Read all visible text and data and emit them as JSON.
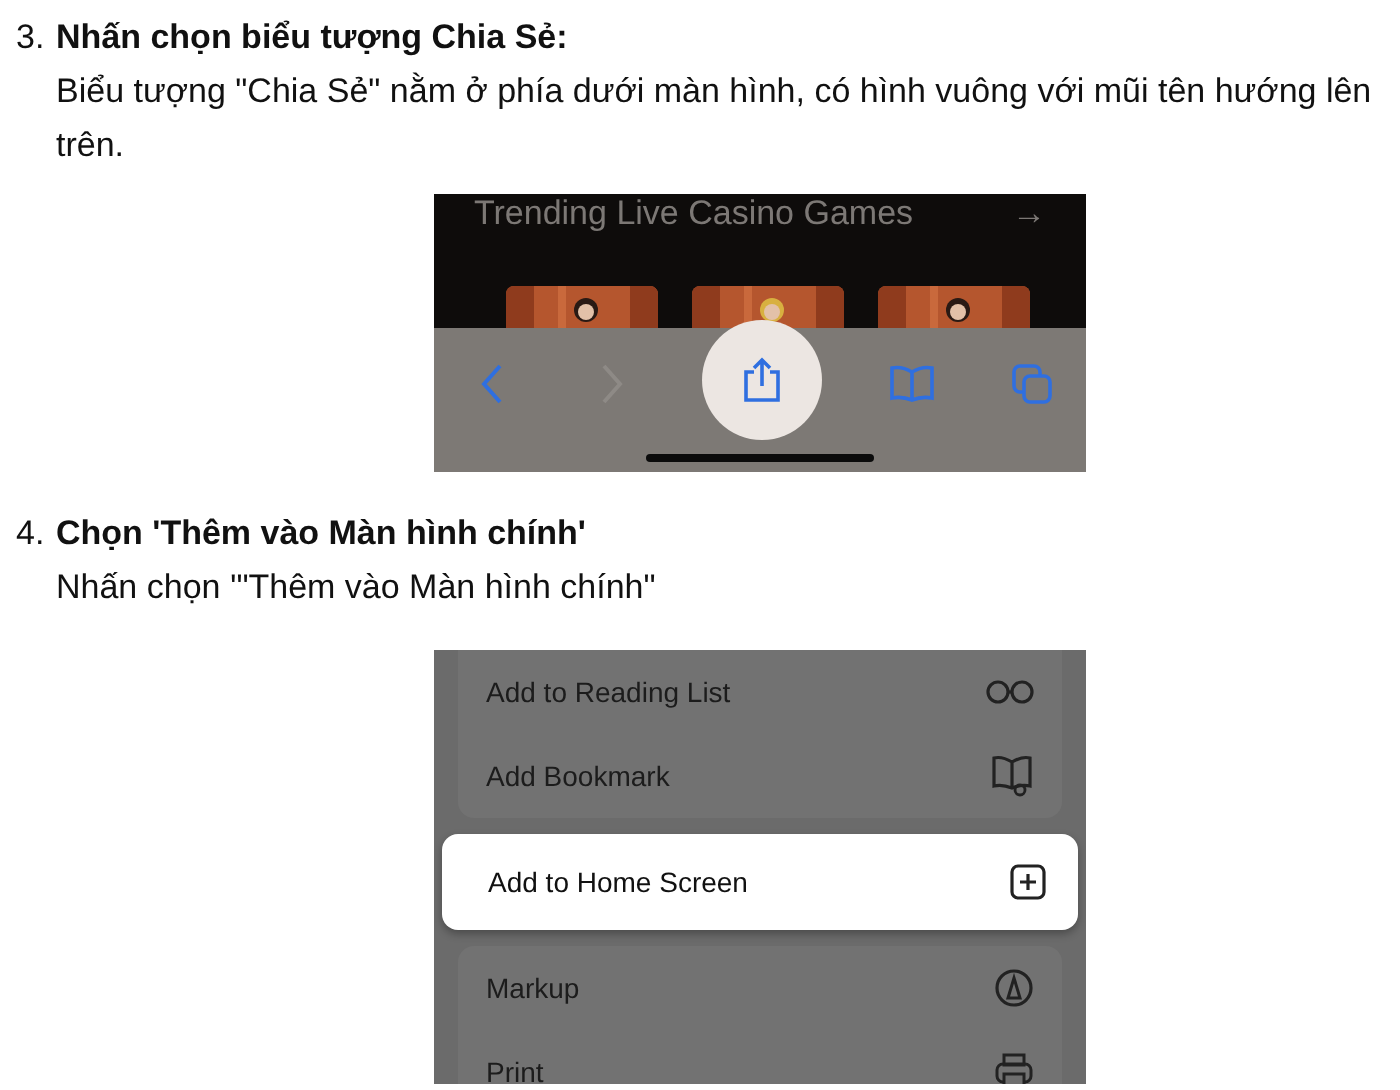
{
  "steps": [
    {
      "number": "3.",
      "title": "Nhấn chọn biểu tượng Chia Sẻ:",
      "description": "Biểu tượng \"Chia Sẻ\" nằm ở phía dưới màn hình, có hình vuông với mũi tên hướng lên trên.",
      "screenshot": {
        "kind": "toolbar",
        "heading": "Trending Live Casino Games",
        "arrow": "→",
        "buttons": [
          {
            "kind": "back",
            "disabled": false,
            "selected": false
          },
          {
            "kind": "forward",
            "disabled": true,
            "selected": false
          },
          {
            "kind": "share",
            "disabled": false,
            "selected": true
          },
          {
            "kind": "bookmarks",
            "disabled": false,
            "selected": false
          },
          {
            "kind": "tabs",
            "disabled": false,
            "selected": false
          }
        ]
      }
    },
    {
      "number": "4.",
      "title": "Chọn 'Thêm vào Màn hình chính'",
      "description": "Nhấn chọn '\"Thêm vào Màn hình chính\"",
      "screenshot": {
        "kind": "menu",
        "groups": [
          {
            "items": [
              {
                "label": "Add to Reading List",
                "kind": "glasses",
                "selected": false
              },
              {
                "label": "Add Bookmark",
                "kind": "book",
                "selected": false
              }
            ]
          },
          {
            "items": [
              {
                "label": "Add to Home Screen",
                "kind": "add",
                "selected": true
              }
            ]
          },
          {
            "items": [
              {
                "label": "Markup",
                "kind": "markup",
                "selected": false
              },
              {
                "label": "Print",
                "kind": "printer",
                "selected": false
              }
            ]
          }
        ]
      }
    }
  ]
}
